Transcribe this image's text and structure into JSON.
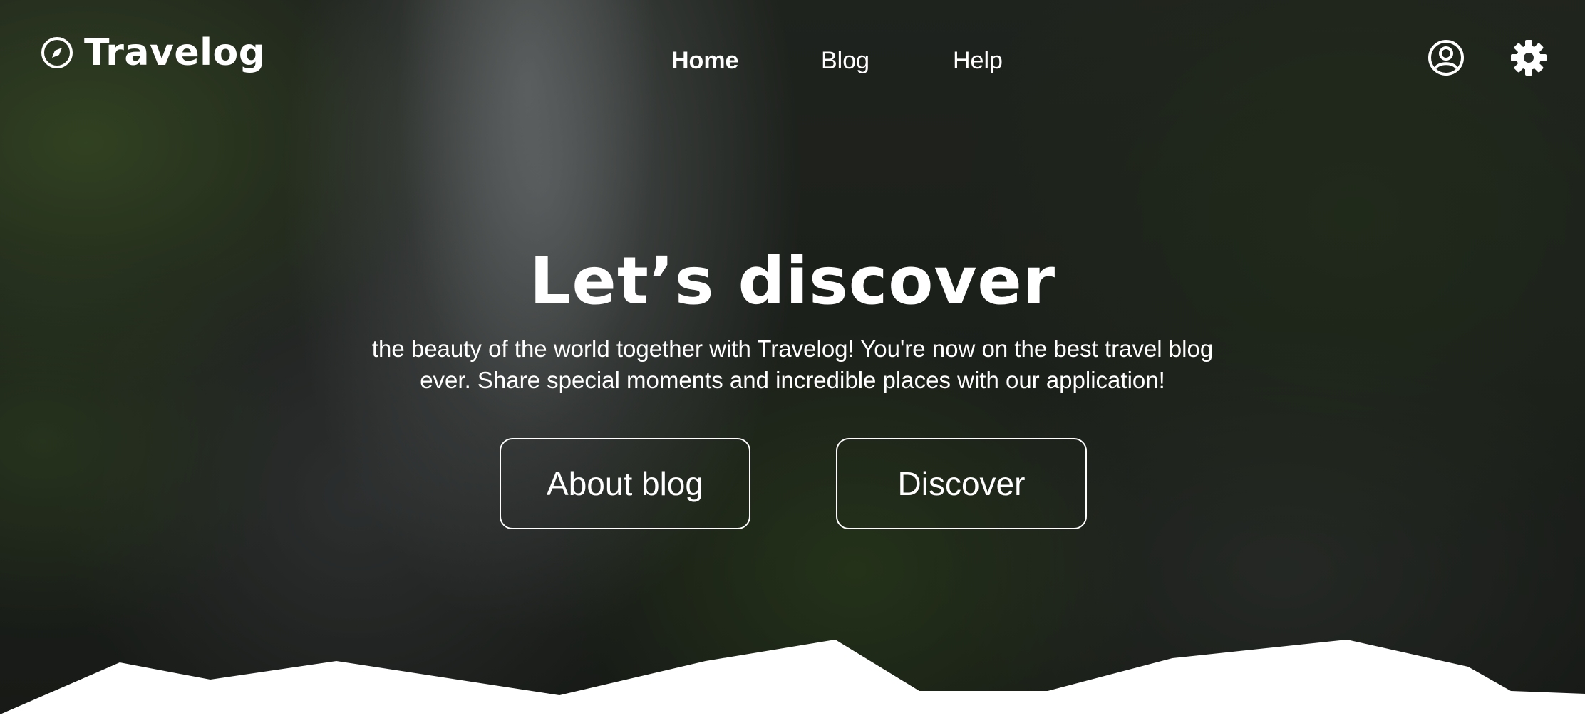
{
  "brand": {
    "name": "Travelog",
    "icon": "compass-icon"
  },
  "nav": {
    "items": [
      {
        "label": "Home",
        "active": true
      },
      {
        "label": "Blog",
        "active": false
      },
      {
        "label": "Help",
        "active": false
      }
    ]
  },
  "header_icons": {
    "account": "user-circle-icon",
    "settings": "gear-icon"
  },
  "hero": {
    "title": "Let’s discover",
    "subtitle": "the beauty of the world together with Travelog! You're now on the best travel blog ever. Share special moments and incredible places with our application!",
    "buttons": {
      "about": "About blog",
      "discover": "Discover"
    }
  },
  "colors": {
    "text": "#ffffff",
    "footer_shape": "#ffffff"
  }
}
